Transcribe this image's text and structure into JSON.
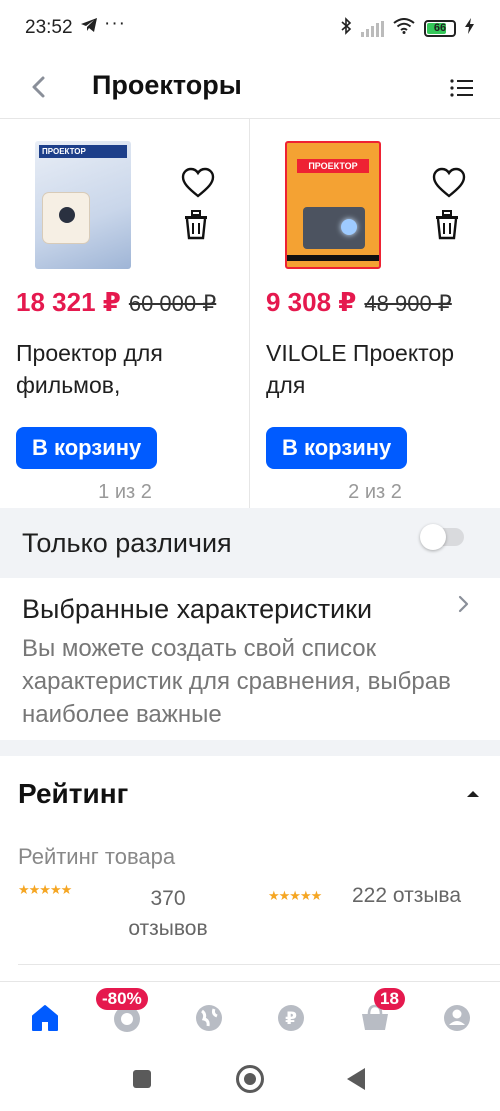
{
  "status_bar": {
    "time": "23:52",
    "battery": "66",
    "icons": [
      "telegram-icon",
      "more-dots-icon",
      "bluetooth-icon",
      "signal-icon",
      "wifi-icon",
      "battery-icon",
      "charging-icon"
    ]
  },
  "header": {
    "title": "Проекторы",
    "back_icon": "arrow-left-icon",
    "menu_icon": "list-menu-icon"
  },
  "products": [
    {
      "price": "18 321 ₽",
      "old_price": "60 000 ₽",
      "name": "Проектор для фильмов,",
      "cart_label": "В корзину",
      "pager": "1 из 2",
      "image_text": "ПРОЕКТОР"
    },
    {
      "price": "9 308 ₽",
      "old_price": "48 900 ₽",
      "name": "VILOLE Проектор для",
      "cart_label": "В корзину",
      "pager": "2 из 2",
      "image_text": "ПРОЕКТОР"
    }
  ],
  "differences": {
    "label": "Только различия",
    "enabled": false
  },
  "selected": {
    "title": "Выбранные характеристики",
    "description": "Вы можете создать свой список характеристик для сравнения, выбрав наиболее важные"
  },
  "rating": {
    "heading": "Рейтинг",
    "label": "Рейтинг товара",
    "stars": "★★★★★",
    "count_1": "370 отзывов",
    "count_2": "222 отзыва"
  },
  "bottom_nav": {
    "items": [
      "home-icon",
      "discount-icon",
      "globe-icon",
      "ruble-icon",
      "cart-icon",
      "profile-icon"
    ],
    "discount_badge": "-80%",
    "cart_badge": "18"
  },
  "colors": {
    "accent": "#005bff",
    "price": "#e5194e",
    "star": "#f5a623"
  }
}
